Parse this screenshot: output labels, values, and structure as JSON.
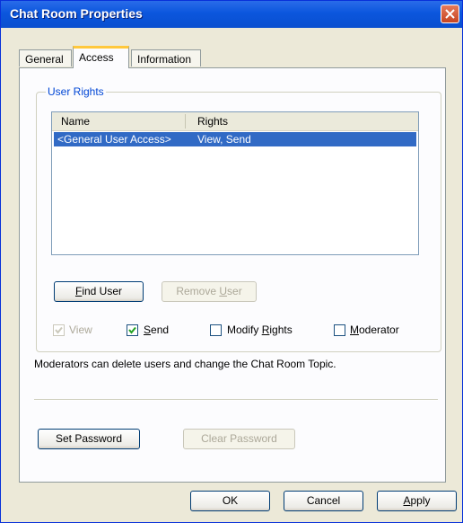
{
  "window": {
    "title": "Chat Room Properties"
  },
  "tabs": [
    {
      "label": "General",
      "active": false
    },
    {
      "label": "Access",
      "active": true
    },
    {
      "label": "Information",
      "active": false
    }
  ],
  "user_rights": {
    "group_label": "User Rights",
    "columns": [
      "Name",
      "Rights"
    ],
    "rows": [
      {
        "name": "<General User Access>",
        "rights": "View, Send",
        "selected": true
      }
    ],
    "find_user": {
      "label_pre": "",
      "label_u": "F",
      "label_post": "ind User"
    },
    "remove_user": {
      "label_pre": "Remove ",
      "label_u": "U",
      "label_post": "ser",
      "enabled": false
    },
    "checks": {
      "view": {
        "label": "View",
        "checked": true,
        "enabled": false
      },
      "send": {
        "label_u": "S",
        "label_post": "end",
        "checked": true,
        "enabled": true
      },
      "modify": {
        "label_pre": "Modify ",
        "label_u": "R",
        "label_post": "ights",
        "checked": false,
        "enabled": true
      },
      "moderator": {
        "label_u": "M",
        "label_post": "oderator",
        "checked": false,
        "enabled": true
      }
    }
  },
  "note": "Moderators can delete users and change the Chat Room Topic.",
  "set_password": "Set Password",
  "clear_password": {
    "label": "Clear Password",
    "enabled": false
  },
  "footer": {
    "ok": "OK",
    "cancel": "Cancel",
    "apply_u": "A",
    "apply_post": "pply"
  },
  "colors": {
    "titlebar": "#0B56DD",
    "selection": "#316AC5",
    "tab_highlight": "#FFC83C",
    "face": "#ECE9D8"
  }
}
